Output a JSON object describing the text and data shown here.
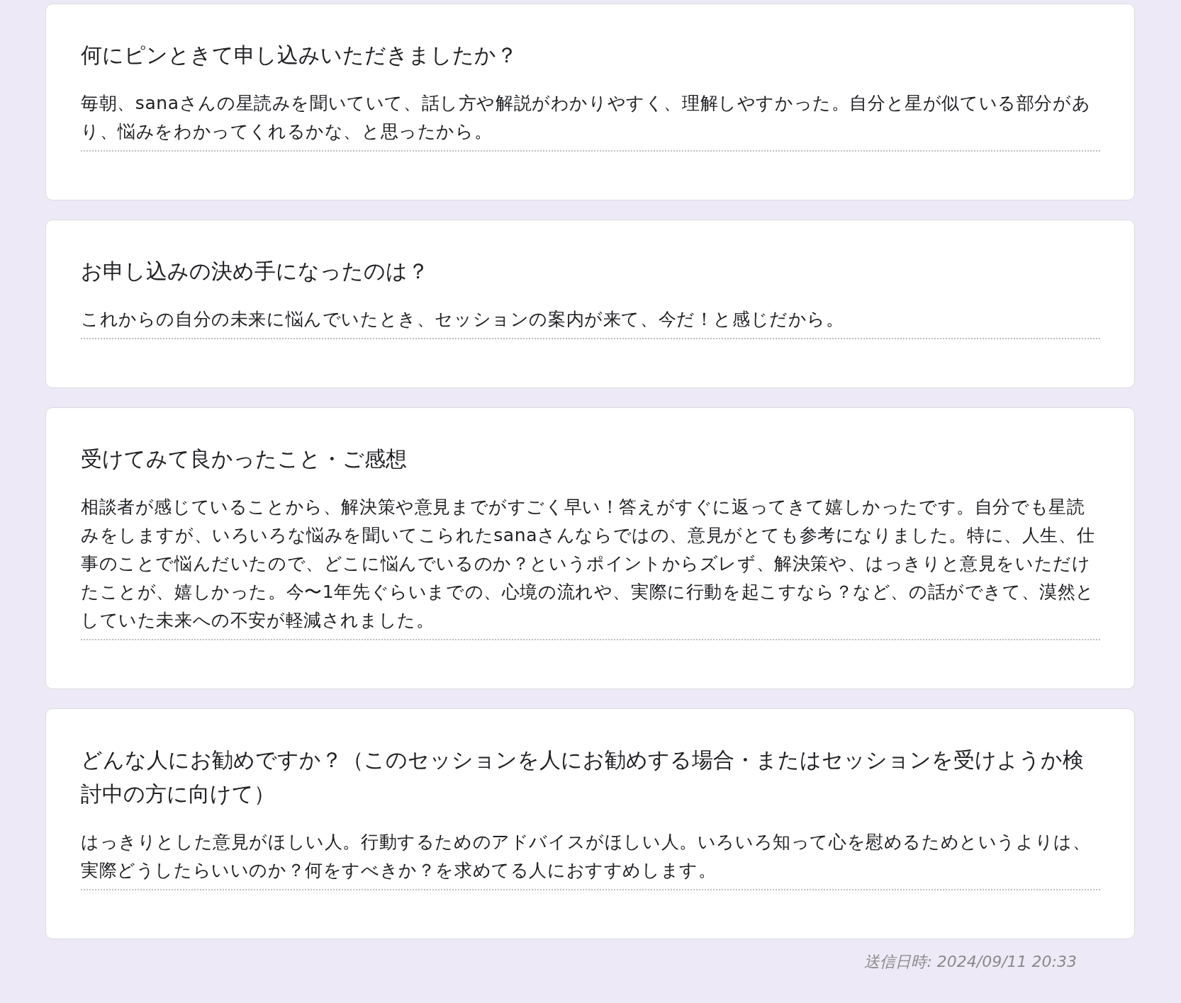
{
  "responses": [
    {
      "question": "何にピンときて申し込みいただきましたか？",
      "answer": "毎朝、sanaさんの星読みを聞いていて、話し方や解説がわかりやすく、理解しやすかった。自分と星が似ている部分があり、悩みをわかってくれるかな、と思ったから。"
    },
    {
      "question": "お申し込みの決め手になったのは？",
      "answer": "これからの自分の未来に悩んでいたとき、セッションの案内が来て、今だ！と感じだから。"
    },
    {
      "question": "受けてみて良かったこと・ご感想",
      "answer": "相談者が感じていることから、解決策や意見までがすごく早い！答えがすぐに返ってきて嬉しかったです。自分でも星読みをしますが、いろいろな悩みを聞いてこられたsanaさんならではの、意見がとても参考になりました。特に、人生、仕事のことで悩んだいたので、どこに悩んでいるのか？というポイントからズレず、解決策や、はっきりと意見をいただけたことが、嬉しかった。今〜1年先ぐらいまでの、心境の流れや、実際に行動を起こすなら？など、の話ができて、漠然としていた未来への不安が軽減されました。"
    },
    {
      "question": "どんな人にお勧めですか？（このセッションを人にお勧めする場合・またはセッションを受けようか検討中の方に向けて）",
      "answer": "はっきりとした意見がほしい人。行動するためのアドバイスがほしい人。いろいろ知って心を慰めるためというよりは、実際どうしたらいいのか？何をすべきか？を求めてる人におすすめします。"
    }
  ],
  "footer": {
    "submitted": "送信日時: 2024/09/11 20:33"
  }
}
